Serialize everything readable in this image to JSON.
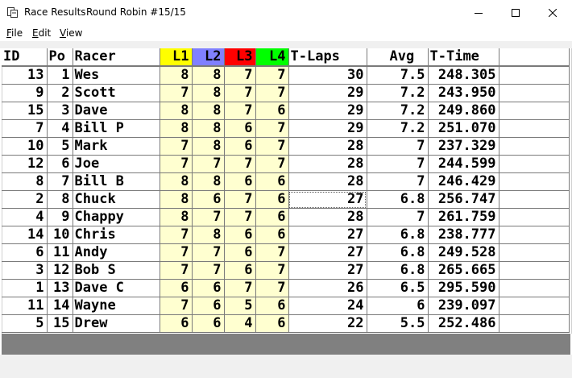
{
  "window": {
    "title_app": "Race Results",
    "title_event": "Round Robin #15/15",
    "minimize_glyph": "—",
    "maximize_glyph": "☐",
    "close_glyph": "✕"
  },
  "menu": [
    {
      "accel": "F",
      "rest": "ile"
    },
    {
      "accel": "E",
      "rest": "dit"
    },
    {
      "accel": "V",
      "rest": "iew"
    }
  ],
  "columns": {
    "id": "ID",
    "pos": "Po",
    "racer": "Racer",
    "l1": "L1",
    "l2": "L2",
    "l3": "L3",
    "l4": "L4",
    "tlaps": "T-Laps",
    "avg": "Avg",
    "ttime": "T-Time"
  },
  "lane_colors": {
    "l1": "#ffff00",
    "l2": "#8080ff",
    "l3": "#ff0000",
    "l4": "#00ff00"
  },
  "rows": [
    {
      "id": "13",
      "pos": "1",
      "racer": "Wes",
      "l1": "8",
      "l2": "8",
      "l3": "7",
      "l4": "7",
      "tlaps": "30",
      "avg": "7.5",
      "ttime": "248.305"
    },
    {
      "id": "9",
      "pos": "2",
      "racer": "Scott",
      "l1": "7",
      "l2": "8",
      "l3": "7",
      "l4": "7",
      "tlaps": "29",
      "avg": "7.2",
      "ttime": "243.950"
    },
    {
      "id": "15",
      "pos": "3",
      "racer": "Dave",
      "l1": "8",
      "l2": "8",
      "l3": "7",
      "l4": "6",
      "tlaps": "29",
      "avg": "7.2",
      "ttime": "249.860"
    },
    {
      "id": "7",
      "pos": "4",
      "racer": "Bill P",
      "l1": "8",
      "l2": "8",
      "l3": "6",
      "l4": "7",
      "tlaps": "29",
      "avg": "7.2",
      "ttime": "251.070"
    },
    {
      "id": "10",
      "pos": "5",
      "racer": "Mark",
      "l1": "7",
      "l2": "8",
      "l3": "6",
      "l4": "7",
      "tlaps": "28",
      "avg": "7",
      "ttime": "237.329"
    },
    {
      "id": "12",
      "pos": "6",
      "racer": "Joe",
      "l1": "7",
      "l2": "7",
      "l3": "7",
      "l4": "7",
      "tlaps": "28",
      "avg": "7",
      "ttime": "244.599"
    },
    {
      "id": "8",
      "pos": "7",
      "racer": "Bill B",
      "l1": "8",
      "l2": "8",
      "l3": "6",
      "l4": "6",
      "tlaps": "28",
      "avg": "7",
      "ttime": "246.429"
    },
    {
      "id": "2",
      "pos": "8",
      "racer": "Chuck",
      "l1": "8",
      "l2": "6",
      "l3": "7",
      "l4": "6",
      "tlaps": "27",
      "avg": "6.8",
      "ttime": "256.747"
    },
    {
      "id": "4",
      "pos": "9",
      "racer": "Chappy",
      "l1": "8",
      "l2": "7",
      "l3": "7",
      "l4": "6",
      "tlaps": "28",
      "avg": "7",
      "ttime": "261.759"
    },
    {
      "id": "14",
      "pos": "10",
      "racer": "Chris",
      "l1": "7",
      "l2": "8",
      "l3": "6",
      "l4": "6",
      "tlaps": "27",
      "avg": "6.8",
      "ttime": "238.777"
    },
    {
      "id": "6",
      "pos": "11",
      "racer": "Andy",
      "l1": "7",
      "l2": "7",
      "l3": "6",
      "l4": "7",
      "tlaps": "27",
      "avg": "6.8",
      "ttime": "249.528"
    },
    {
      "id": "3",
      "pos": "12",
      "racer": "Bob S",
      "l1": "7",
      "l2": "7",
      "l3": "6",
      "l4": "7",
      "tlaps": "27",
      "avg": "6.8",
      "ttime": "265.665"
    },
    {
      "id": "1",
      "pos": "13",
      "racer": "Dave C",
      "l1": "6",
      "l2": "6",
      "l3": "7",
      "l4": "7",
      "tlaps": "26",
      "avg": "6.5",
      "ttime": "295.590"
    },
    {
      "id": "11",
      "pos": "14",
      "racer": "Wayne",
      "l1": "7",
      "l2": "6",
      "l3": "5",
      "l4": "6",
      "tlaps": "24",
      "avg": "6",
      "ttime": "239.097"
    },
    {
      "id": "5",
      "pos": "15",
      "racer": "Drew",
      "l1": "6",
      "l2": "6",
      "l3": "4",
      "l4": "6",
      "tlaps": "22",
      "avg": "5.5",
      "ttime": "252.486"
    }
  ],
  "focused_cell": {
    "row": 7,
    "column": "tlaps"
  }
}
